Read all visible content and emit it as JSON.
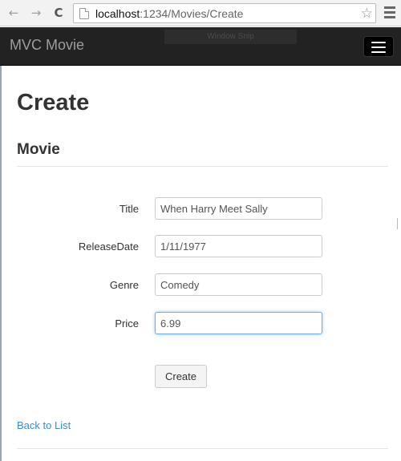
{
  "browser": {
    "back_icon": "←",
    "forward_icon": "→",
    "reload_icon": "C",
    "url_host": "localhost",
    "url_path": ":1234/Movies/Create",
    "star_icon": "☆"
  },
  "navbar": {
    "brand": "MVC Movie",
    "overlay_text": "Window Snip"
  },
  "page": {
    "title": "Create",
    "subtitle": "Movie"
  },
  "form": {
    "fields": [
      {
        "label": "Title",
        "value": "When Harry Meet Sally"
      },
      {
        "label": "ReleaseDate",
        "value": "1/11/1977"
      },
      {
        "label": "Genre",
        "value": "Comedy"
      },
      {
        "label": "Price",
        "value": "6.99"
      }
    ],
    "submit_label": "Create"
  },
  "footer": {
    "back_link": "Back to List"
  },
  "colors": {
    "navbar_bg": "#222222",
    "link": "#428bca",
    "focus_border": "#66afe9"
  }
}
